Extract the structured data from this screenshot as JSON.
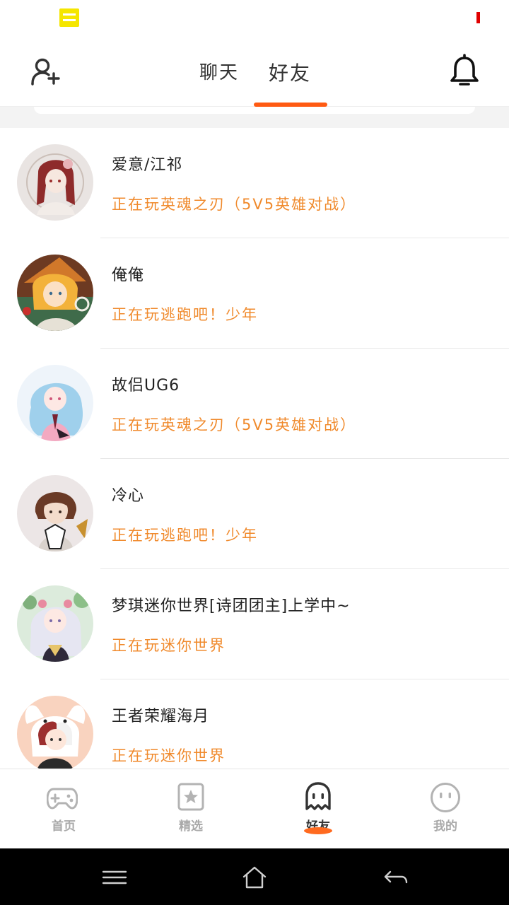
{
  "header": {
    "tabs": [
      {
        "label": "聊天",
        "active": false
      },
      {
        "label": "好友",
        "active": true
      }
    ],
    "accent_color": "#ff5a12"
  },
  "friends": [
    {
      "name": "爱意/江祁",
      "status": "正在玩英魂之刃（5V5英雄对战）",
      "avatar_icon": "avatar-girl-red-hair"
    },
    {
      "name": "俺俺",
      "status": "正在玩逃跑吧！少年",
      "avatar_icon": "avatar-girl-witch-hat"
    },
    {
      "name": "故侣UG6",
      "status": "正在玩英魂之刃（5V5英雄对战）",
      "avatar_icon": "avatar-girl-blue-hair"
    },
    {
      "name": "冷心",
      "status": "正在玩逃跑吧！少年",
      "avatar_icon": "avatar-boy-brown-hair"
    },
    {
      "name": "梦琪迷你世界[诗团团主]上学中~",
      "status": "正在玩迷你世界",
      "avatar_icon": "avatar-girl-white-hair"
    },
    {
      "name": "王者荣耀海月",
      "status": "正在玩迷你世界",
      "avatar_icon": "avatar-boy-bunny-hood"
    }
  ],
  "status_color": "#f08a2c",
  "bottom_nav": [
    {
      "label": "首页",
      "icon": "gamepad-icon",
      "active": false
    },
    {
      "label": "精选",
      "icon": "star-badge-icon",
      "active": false
    },
    {
      "label": "好友",
      "icon": "ghost-icon",
      "active": true
    },
    {
      "label": "我的",
      "icon": "smiley-icon",
      "active": false
    }
  ]
}
